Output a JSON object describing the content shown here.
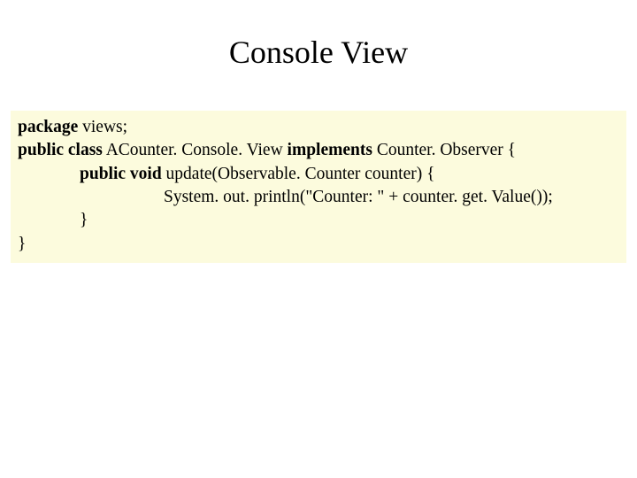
{
  "title": "Console View",
  "code": {
    "line1_kw": "package",
    "line1_rest": " views;",
    "line2_kw1": "public class",
    "line2_mid": " ACounter. Console. View ",
    "line2_kw2": "implements",
    "line2_end": " Counter. Observer {",
    "line3_kw": "public void",
    "line3_rest": " update(Observable. Counter counter) {",
    "line4": "System. out. println(\"Counter: \" + counter. get. Value());",
    "line5": "}",
    "line6": "}"
  }
}
